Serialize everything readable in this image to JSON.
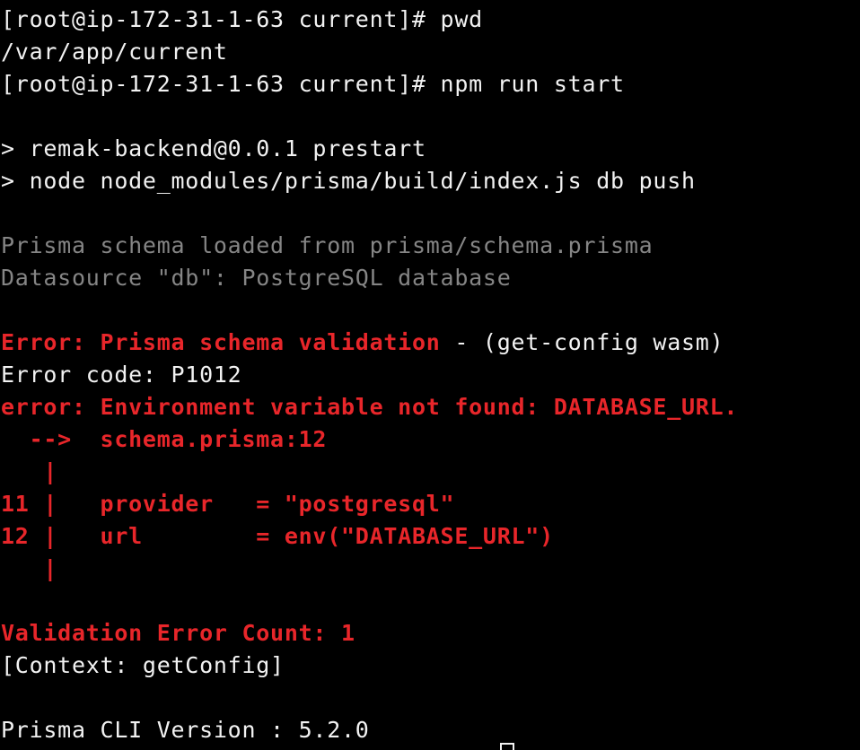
{
  "terminal": {
    "lines": [
      {
        "segments": [
          {
            "text": "[root@ip-172-31-1-63 current]# pwd",
            "style": "white"
          }
        ]
      },
      {
        "segments": [
          {
            "text": "/var/app/current",
            "style": "white"
          }
        ]
      },
      {
        "segments": [
          {
            "text": "[root@ip-172-31-1-63 current]# npm run start",
            "style": "white"
          }
        ]
      },
      {
        "segments": [
          {
            "text": "",
            "style": "white"
          }
        ]
      },
      {
        "segments": [
          {
            "text": "> remak-backend@0.0.1 prestart",
            "style": "white"
          }
        ]
      },
      {
        "segments": [
          {
            "text": "> node node_modules/prisma/build/index.js db push",
            "style": "white"
          }
        ]
      },
      {
        "segments": [
          {
            "text": "",
            "style": "white"
          }
        ]
      },
      {
        "segments": [
          {
            "text": "Prisma schema loaded from prisma/schema.prisma",
            "style": "gray"
          }
        ]
      },
      {
        "segments": [
          {
            "text": "Datasource \"db\": PostgreSQL database",
            "style": "gray"
          }
        ]
      },
      {
        "segments": [
          {
            "text": "",
            "style": "white"
          }
        ]
      },
      {
        "segments": [
          {
            "text": "Error: Prisma schema validation",
            "style": "red"
          },
          {
            "text": " - (get-config wasm)",
            "style": "white"
          }
        ]
      },
      {
        "segments": [
          {
            "text": "Error code: P1012",
            "style": "white"
          }
        ]
      },
      {
        "segments": [
          {
            "text": "error",
            "style": "red"
          },
          {
            "text": ": ",
            "style": "red"
          },
          {
            "text": "Environment variable not found: DATABASE_URL.",
            "style": "red"
          }
        ]
      },
      {
        "segments": [
          {
            "text": "  -->  ",
            "style": "red"
          },
          {
            "text": "schema.prisma:12",
            "style": "red"
          }
        ]
      },
      {
        "segments": [
          {
            "text": "   |",
            "style": "red"
          }
        ]
      },
      {
        "segments": [
          {
            "text": "11 |",
            "style": "red"
          },
          {
            "text": "   provider   = \"postgresql\"",
            "style": "red"
          }
        ]
      },
      {
        "segments": [
          {
            "text": "12 |",
            "style": "red"
          },
          {
            "text": "   url        = env(\"DATABASE_URL\")",
            "style": "red"
          }
        ]
      },
      {
        "segments": [
          {
            "text": "   |",
            "style": "red"
          }
        ]
      },
      {
        "segments": [
          {
            "text": "",
            "style": "white"
          }
        ]
      },
      {
        "segments": [
          {
            "text": "Validation Error Count: 1",
            "style": "red"
          }
        ]
      },
      {
        "segments": [
          {
            "text": "[Context: getConfig]",
            "style": "white"
          }
        ]
      },
      {
        "segments": [
          {
            "text": "",
            "style": "white"
          }
        ]
      },
      {
        "segments": [
          {
            "text": "Prisma CLI Version : 5.2.0",
            "style": "white"
          }
        ]
      }
    ]
  },
  "colors": {
    "background": "#000000",
    "foreground": "#f2f2f2",
    "dim": "#858585",
    "error": "#e8262a"
  }
}
